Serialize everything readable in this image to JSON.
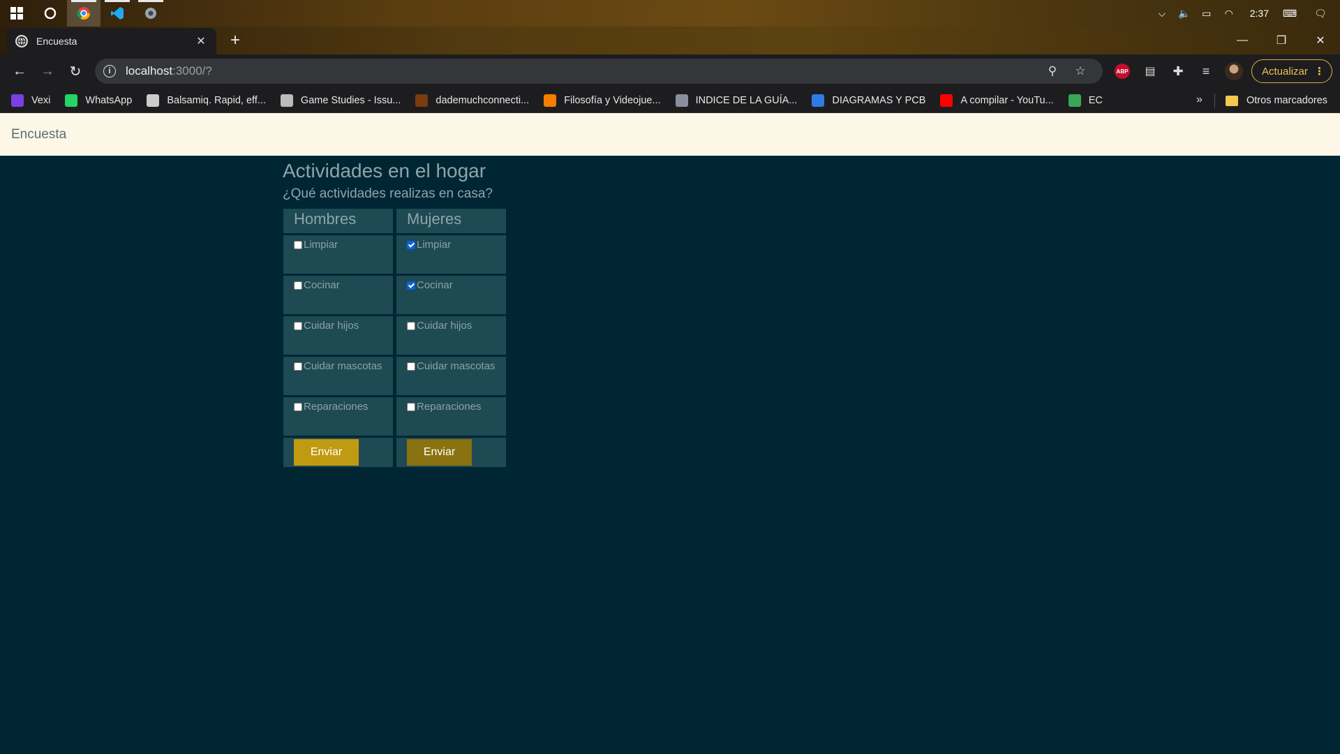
{
  "taskbar": {
    "clock": "2:37",
    "apps": [
      "cortana",
      "chrome",
      "vscode",
      "other-app"
    ]
  },
  "browser": {
    "tab_title": "Encuesta",
    "url_host": "localhost",
    "url_rest": ":3000/?",
    "update_label": "Actualizar",
    "bookmarks": [
      {
        "label": "Vexi",
        "color": "#7b3fe4"
      },
      {
        "label": "WhatsApp",
        "color": "#25d366"
      },
      {
        "label": "Balsamiq. Rapid, eff...",
        "color": "#cccccc"
      },
      {
        "label": "Game Studies - Issu...",
        "color": "#bbbbbb"
      },
      {
        "label": "dademuchconnecti...",
        "color": "#7a3c10"
      },
      {
        "label": "Filosofía y Videojue...",
        "color": "#f57d00"
      },
      {
        "label": "INDICE DE LA GUÍA...",
        "color": "#8a8fa0"
      },
      {
        "label": "DIAGRAMAS Y PCB",
        "color": "#2e7be6"
      },
      {
        "label": "A compilar - YouTu...",
        "color": "#ff0000"
      },
      {
        "label": "EC",
        "color": "#3aa757"
      }
    ],
    "bookmarks_more": "»",
    "other_bookmarks": "Otros marcadores"
  },
  "page": {
    "brand": "Encuesta",
    "title": "Actividades en el hogar",
    "question": "¿Qué actividades realizas en casa?",
    "columns": [
      {
        "header": "Hombres",
        "items": [
          {
            "label": "Limpiar",
            "checked": false
          },
          {
            "label": "Cocinar",
            "checked": false
          },
          {
            "label": "Cuidar hijos",
            "checked": false
          },
          {
            "label": "Cuidar mascotas",
            "checked": false
          },
          {
            "label": "Reparaciones",
            "checked": false
          }
        ],
        "submit_label": "Enviar"
      },
      {
        "header": "Mujeres",
        "items": [
          {
            "label": "Limpiar",
            "checked": true
          },
          {
            "label": "Cocinar",
            "checked": true
          },
          {
            "label": "Cuidar hijos",
            "checked": false
          },
          {
            "label": "Cuidar mascotas",
            "checked": false
          },
          {
            "label": "Reparaciones",
            "checked": false
          }
        ],
        "submit_label": "Enviar"
      }
    ]
  },
  "colors": {
    "page_bg": "#002634",
    "cell_bg": "#1e4a53",
    "navbar_bg": "#fdf7e7",
    "button_hombres": "#c09b12",
    "button_mujeres": "#8a7210"
  }
}
